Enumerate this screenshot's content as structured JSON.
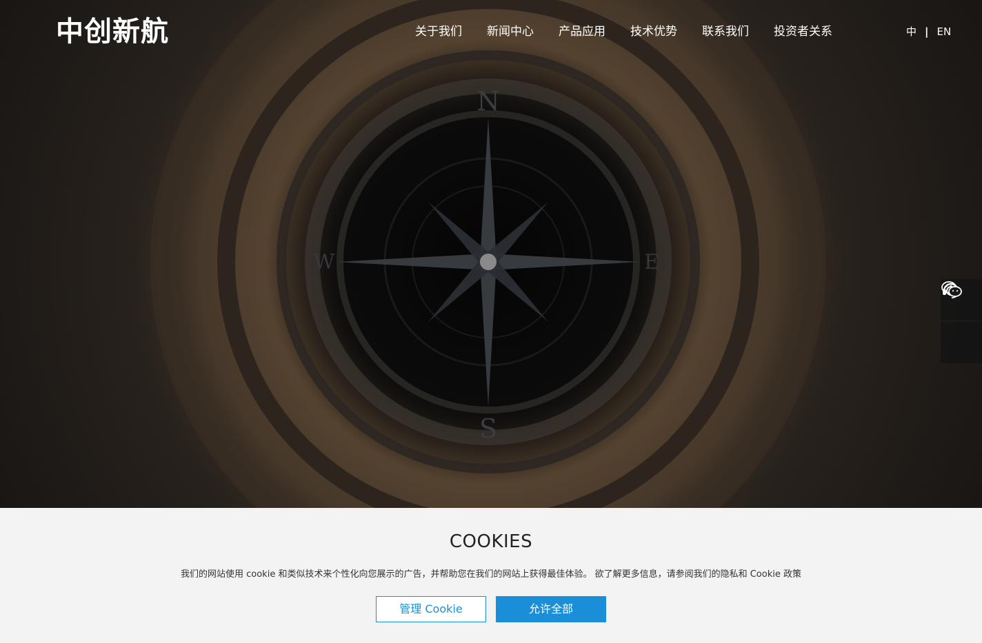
{
  "header": {
    "logo": "中创新航",
    "nav": [
      "关于我们",
      "新闻中心",
      "产品应用",
      "技术优势",
      "联系我们",
      "投资者关系"
    ],
    "lang_cn": "中",
    "lang_sep": "|",
    "lang_en": "EN"
  },
  "hero": {
    "compass_n": "N",
    "compass_s": "S",
    "compass_w": "W",
    "compass_e": "E"
  },
  "side_buttons": {
    "service_icon": "headset-icon",
    "wechat_icon": "wechat-icon"
  },
  "cookie": {
    "title": "COOKIES",
    "text": "我们的网站使用 cookie 和类似技术来个性化向您展示的广告，并帮助您在我们的网站上获得最佳体验。 欲了解更多信息，请参阅我们的隐私和 Cookie 政策",
    "manage_label": "管理 Cookie",
    "accept_label": "允许全部"
  },
  "colors": {
    "accent": "#1a8fd8",
    "banner_bg": "#f3f3f3"
  }
}
